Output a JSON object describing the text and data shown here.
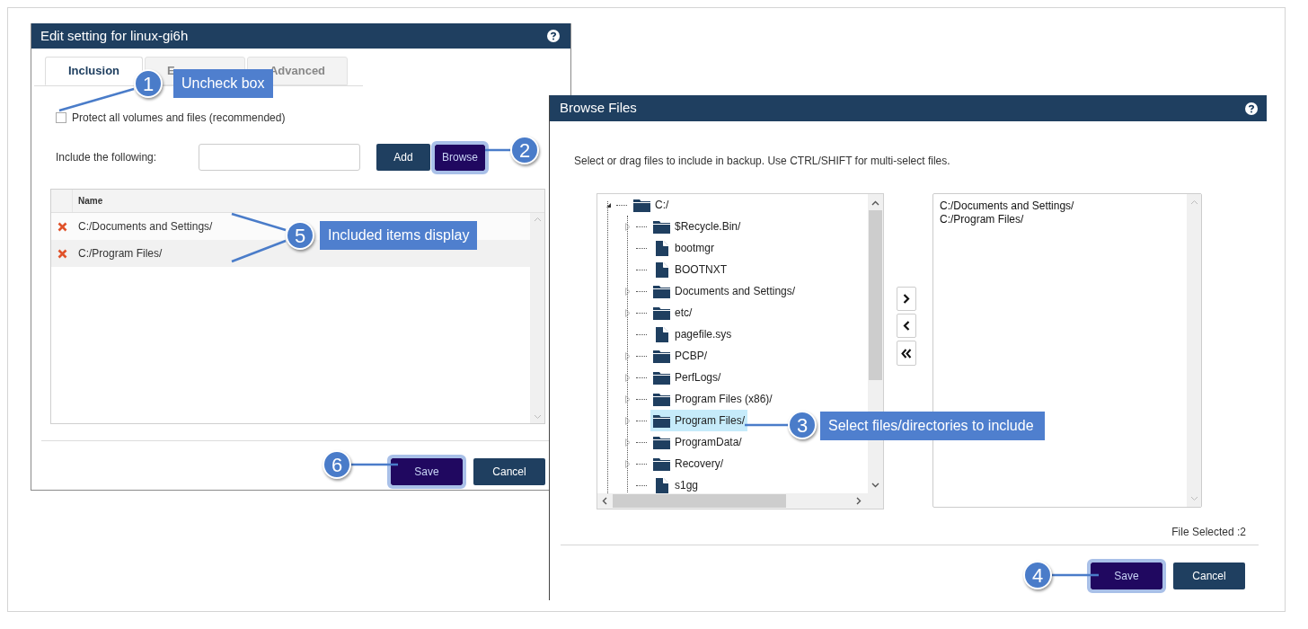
{
  "edit_dialog": {
    "title": "Edit setting for linux-gi6h",
    "tabs": [
      {
        "label": "Inclusion",
        "selected": true
      },
      {
        "label": "E",
        "selected": false
      },
      {
        "label": "Advanced",
        "selected": false
      }
    ],
    "protect_all": {
      "label": "Protect all volumes and files (recommended)",
      "checked": false
    },
    "include_label": "Include the following:",
    "add_button": "Add",
    "browse_button": {
      "label": "Browse",
      "highlighted": true
    },
    "table": {
      "columns": [
        "Name"
      ],
      "rows": [
        {
          "name": "C:/Documents and Settings/"
        },
        {
          "name": "C:/Program Files/"
        }
      ]
    },
    "buttons": [
      {
        "label": "Save",
        "highlighted": true
      },
      {
        "label": "Cancel",
        "highlighted": false
      }
    ]
  },
  "browse_dialog": {
    "title": "Browse Files",
    "instruction": "Select or drag files to include in backup. Use CTRL/SHIFT for multi-select files.",
    "tree": [
      {
        "label": "C:/",
        "kind": "folder",
        "expanded": true,
        "selected": false,
        "children": [
          {
            "label": "$Recycle.Bin/",
            "kind": "folder",
            "expanded": false,
            "selected": false
          },
          {
            "label": "bootmgr",
            "kind": "file",
            "selected": false
          },
          {
            "label": "BOOTNXT",
            "kind": "file",
            "selected": false
          },
          {
            "label": "Documents and Settings/",
            "kind": "folder",
            "expanded": false,
            "selected": false
          },
          {
            "label": "etc/",
            "kind": "folder",
            "expanded": false,
            "selected": false
          },
          {
            "label": "pagefile.sys",
            "kind": "file",
            "selected": false
          },
          {
            "label": "PCBP/",
            "kind": "folder",
            "expanded": false,
            "selected": false
          },
          {
            "label": "PerfLogs/",
            "kind": "folder",
            "expanded": false,
            "selected": false
          },
          {
            "label": "Program Files (x86)/",
            "kind": "folder",
            "expanded": false,
            "selected": false
          },
          {
            "label": "Program Files/",
            "kind": "folder",
            "expanded": false,
            "selected": true
          },
          {
            "label": "ProgramData/",
            "kind": "folder",
            "expanded": false,
            "selected": false
          },
          {
            "label": "Recovery/",
            "kind": "folder",
            "expanded": false,
            "selected": false
          },
          {
            "label": "s1gg",
            "kind": "file",
            "selected": false
          }
        ]
      }
    ],
    "selected_list": [
      "C:/Documents and Settings/",
      "C:/Program Files/"
    ],
    "status": "File Selected :2",
    "buttons": [
      {
        "label": "Save",
        "highlighted": true
      },
      {
        "label": "Cancel",
        "highlighted": false
      }
    ]
  },
  "annotations": [
    {
      "number": "1",
      "text": "Uncheck box"
    },
    {
      "number": "2"
    },
    {
      "number": "3",
      "text": "Select files/directories to include"
    },
    {
      "number": "4"
    },
    {
      "number": "5",
      "text": "Included items display"
    },
    {
      "number": "6"
    }
  ]
}
